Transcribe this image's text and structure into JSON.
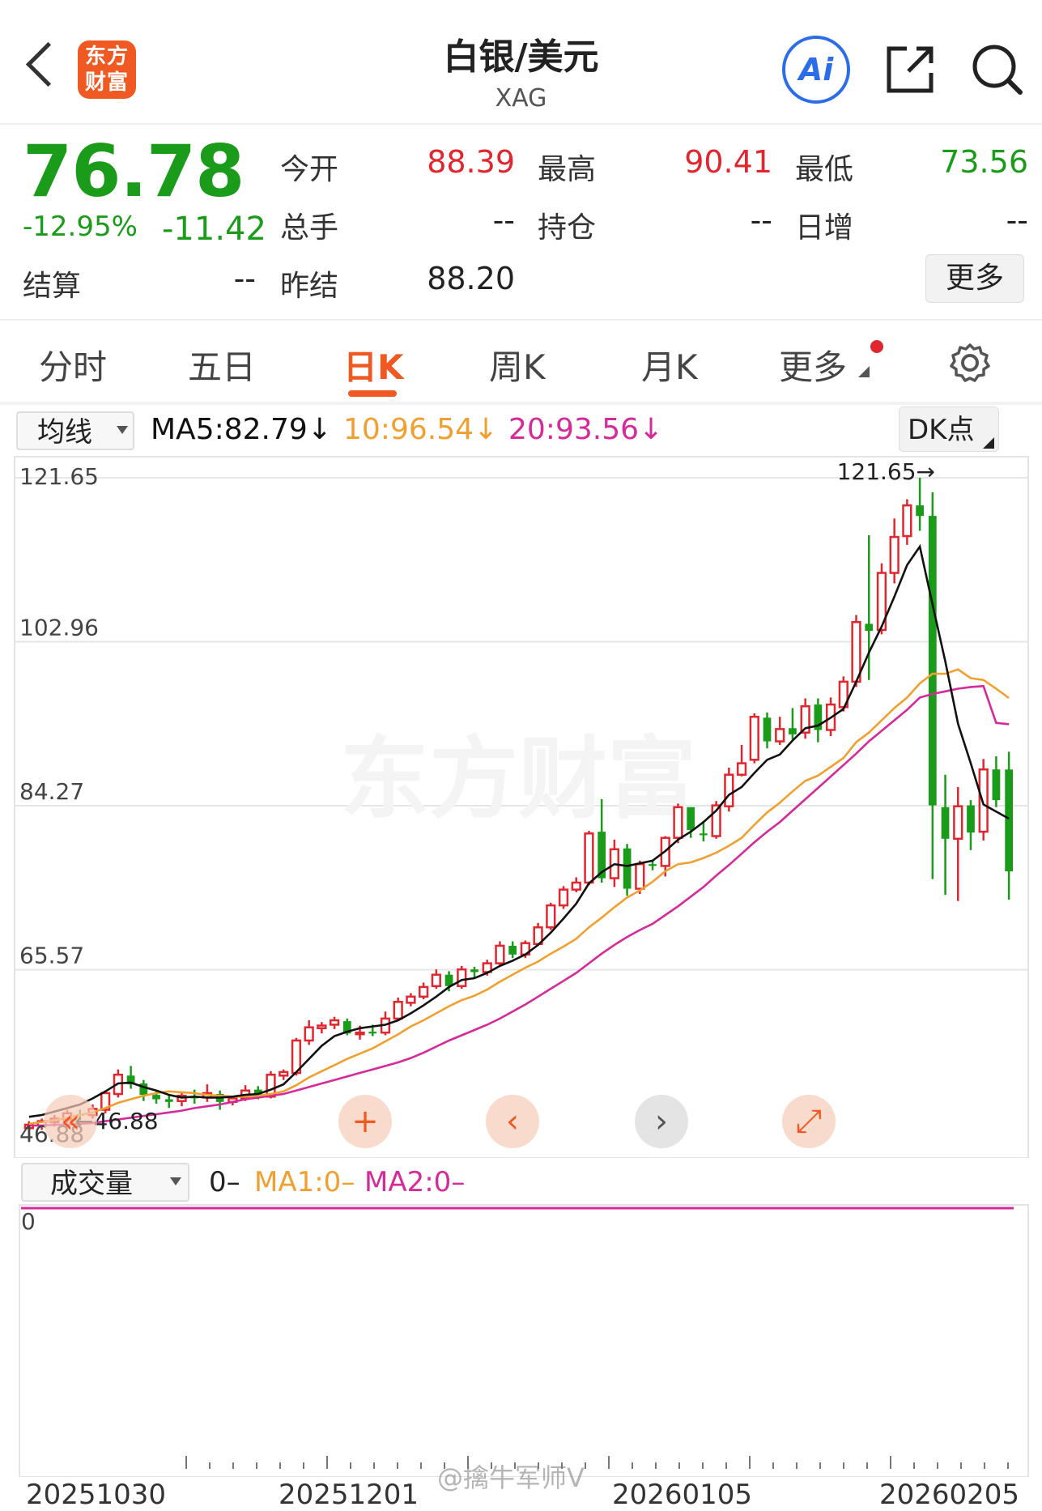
{
  "header": {
    "logo_line1": "东方",
    "logo_line2": "财富",
    "title": "白银/美元",
    "subtitle": "XAG",
    "ai_label": "Ai"
  },
  "quote": {
    "price": "76.78",
    "change_pct": "-12.95%",
    "change": "-11.42",
    "open_label": "今开",
    "open": "88.39",
    "high_label": "最高",
    "high": "90.41",
    "low_label": "最低",
    "low": "73.56",
    "volume_label": "总手",
    "volume": "--",
    "oi_label": "持仓",
    "oi": "--",
    "daily_inc_label": "日增",
    "daily_inc": "--",
    "settle_label": "结算",
    "settle": "--",
    "prev_settle_label": "昨结",
    "prev_settle": "88.20",
    "more_label": "更多"
  },
  "tabs": [
    "分时",
    "五日",
    "日K",
    "周K",
    "月K",
    "更多"
  ],
  "ma_bar": {
    "select_label": "均线",
    "ma5": "MA5:82.79↓",
    "ma10": "10:96.54↓",
    "ma20": "20:93.56↓",
    "dk_label": "DK点"
  },
  "colors": {
    "up": "#e0262e",
    "down": "#1a9b1a",
    "ma5": "#111111",
    "ma10": "#f0a030",
    "ma20": "#d42a9a",
    "accent": "#f05a22"
  },
  "watermark": "东方财富",
  "social_watermark": "@擒牛军师V",
  "chart_data": {
    "type": "candlestick",
    "y_ticks": [
      "121.65",
      "102.96",
      "84.27",
      "65.57"
    ],
    "ylim": [
      46.88,
      121.65
    ],
    "high_marker": "121.65→",
    "low_marker": "←46.88",
    "low_axis_label": "46.88",
    "candles": [
      [
        47.5,
        47.9,
        46.9,
        48.3
      ],
      [
        47.8,
        48.3,
        47.3,
        48.6
      ],
      [
        48.2,
        48.6,
        47.7,
        49.0
      ],
      [
        48.5,
        49.2,
        48.1,
        49.6
      ],
      [
        49.1,
        49.0,
        48.4,
        49.6
      ],
      [
        49.0,
        49.7,
        48.6,
        50.2
      ],
      [
        49.6,
        51.5,
        49.2,
        51.8
      ],
      [
        51.4,
        53.6,
        51.0,
        54.2
      ],
      [
        53.5,
        52.5,
        52.0,
        54.6
      ],
      [
        52.6,
        51.3,
        50.6,
        53.0
      ],
      [
        51.3,
        50.8,
        50.3,
        51.8
      ],
      [
        50.8,
        50.5,
        49.8,
        51.4
      ],
      [
        50.6,
        51.2,
        50.0,
        51.6
      ],
      [
        51.1,
        50.9,
        50.3,
        51.9
      ],
      [
        51.0,
        51.5,
        50.5,
        52.5
      ],
      [
        51.4,
        50.5,
        49.6,
        51.8
      ],
      [
        50.5,
        50.9,
        50.1,
        51.2
      ],
      [
        50.9,
        51.8,
        50.6,
        52.4
      ],
      [
        51.9,
        51.0,
        50.8,
        52.3
      ],
      [
        51.1,
        53.6,
        50.9,
        54.0
      ],
      [
        53.5,
        53.9,
        53.0,
        54.2
      ],
      [
        53.8,
        57.5,
        53.5,
        57.8
      ],
      [
        57.5,
        59.0,
        57.0,
        59.8
      ],
      [
        58.9,
        59.2,
        58.3,
        59.6
      ],
      [
        59.3,
        59.8,
        58.8,
        60.2
      ],
      [
        59.7,
        58.3,
        58.1,
        60.0
      ],
      [
        58.4,
        58.4,
        57.6,
        59.2
      ],
      [
        58.5,
        58.3,
        58.0,
        59.3
      ],
      [
        58.4,
        60.0,
        58.1,
        60.8
      ],
      [
        60.0,
        61.9,
        59.8,
        62.4
      ],
      [
        61.8,
        62.5,
        61.4,
        62.9
      ],
      [
        62.5,
        63.6,
        62.2,
        64.1
      ],
      [
        63.7,
        65.0,
        63.4,
        65.6
      ],
      [
        65.0,
        63.7,
        63.1,
        65.4
      ],
      [
        63.7,
        65.6,
        63.4,
        66.0
      ],
      [
        65.6,
        65.3,
        64.6,
        65.9
      ],
      [
        65.3,
        66.3,
        64.9,
        66.7
      ],
      [
        66.3,
        68.3,
        66.0,
        68.8
      ],
      [
        68.3,
        67.3,
        66.9,
        68.8
      ],
      [
        67.3,
        68.6,
        66.9,
        68.9
      ],
      [
        68.5,
        70.4,
        68.3,
        70.9
      ],
      [
        70.4,
        72.9,
        70.1,
        73.2
      ],
      [
        72.9,
        74.7,
        72.5,
        75.1
      ],
      [
        74.7,
        75.5,
        74.4,
        76.1
      ],
      [
        75.5,
        81.1,
        75.2,
        81.4
      ],
      [
        81.3,
        76.0,
        75.5,
        85.0
      ],
      [
        76.0,
        79.3,
        75.0,
        80.4
      ],
      [
        79.4,
        74.8,
        74.0,
        79.9
      ],
      [
        74.8,
        77.6,
        74.2,
        78.0
      ],
      [
        77.6,
        77.4,
        76.9,
        78.1
      ],
      [
        77.4,
        80.6,
        76.2,
        80.8
      ],
      [
        80.6,
        84.1,
        80.0,
        84.5
      ],
      [
        84.1,
        81.5,
        80.6,
        83.2
      ],
      [
        81.1,
        80.9,
        80.2,
        82.5
      ],
      [
        80.8,
        84.3,
        80.5,
        84.8
      ],
      [
        84.2,
        87.8,
        83.6,
        88.6
      ],
      [
        87.8,
        89.1,
        87.6,
        91.2
      ],
      [
        89.5,
        94.4,
        89.1,
        94.8
      ],
      [
        94.3,
        91.6,
        90.8,
        94.9
      ],
      [
        91.6,
        93.0,
        91.2,
        94.4
      ],
      [
        93.1,
        92.4,
        91.8,
        95.4
      ],
      [
        92.6,
        95.6,
        91.9,
        96.5
      ],
      [
        95.8,
        92.9,
        91.5,
        96.5
      ],
      [
        92.9,
        95.8,
        92.2,
        96.6
      ],
      [
        95.5,
        98.4,
        95.0,
        99.0
      ],
      [
        98.4,
        105.2,
        97.8,
        106.0
      ],
      [
        105.0,
        104.2,
        98.6,
        115.1
      ],
      [
        104.3,
        110.8,
        103.8,
        111.9
      ],
      [
        110.8,
        114.9,
        109.6,
        117.0
      ],
      [
        115.0,
        118.5,
        114.0,
        119.2
      ],
      [
        118.5,
        117.3,
        115.6,
        121.65
      ],
      [
        117.3,
        84.3,
        75.9,
        120.0
      ],
      [
        84.1,
        80.5,
        74.1,
        87.8
      ],
      [
        80.5,
        84.2,
        73.4,
        86.4
      ],
      [
        84.3,
        81.2,
        79.2,
        84.9
      ],
      [
        81.3,
        88.4,
        80.3,
        89.6
      ],
      [
        88.4,
        84.9,
        84.1,
        89.9
      ],
      [
        88.39,
        76.78,
        73.56,
        90.41
      ]
    ],
    "ma5": [
      48.8,
      49.0,
      49.4,
      49.8,
      50.2,
      50.9,
      51.7,
      52.6,
      52.7,
      52.2,
      51.8,
      51.3,
      51.0,
      51.1,
      51.0,
      51.0,
      51.1,
      51.3,
      51.4,
      51.9,
      52.5,
      53.9,
      55.4,
      56.9,
      58.0,
      58.5,
      58.9,
      59.1,
      59.3,
      59.8,
      60.6,
      61.5,
      62.5,
      63.6,
      64.4,
      64.6,
      65.2,
      66.0,
      66.6,
      67.3,
      68.4,
      69.8,
      71.4,
      73.1,
      75.4,
      76.7,
      77.6,
      77.4,
      77.7,
      78.0,
      79.1,
      80.4,
      81.3,
      82.4,
      83.7,
      85.5,
      86.4,
      88.0,
      89.5,
      90.1,
      91.7,
      93.1,
      93.4,
      94.3,
      95.3,
      98.4,
      101.7,
      104.7,
      108.1,
      111.7,
      113.8,
      107.2,
      100.7,
      93.6,
      89.1,
      84.4,
      83.6,
      82.79
    ],
    "ma10": [
      48.0,
      48.2,
      48.4,
      48.7,
      49.0,
      49.3,
      49.8,
      50.4,
      50.8,
      51.2,
      51.5,
      51.7,
      51.6,
      51.5,
      51.3,
      51.2,
      51.1,
      51.1,
      51.2,
      51.4,
      51.7,
      52.4,
      53.3,
      54.0,
      54.7,
      55.4,
      56.0,
      56.6,
      57.4,
      58.2,
      59.1,
      59.8,
      60.6,
      61.4,
      62.1,
      62.6,
      63.3,
      64.2,
      65.0,
      65.8,
      66.5,
      67.4,
      68.2,
      69.1,
      70.4,
      71.5,
      72.7,
      73.8,
      74.6,
      75.6,
      76.8,
      77.6,
      77.8,
      78.3,
      78.9,
      79.7,
      80.6,
      82.1,
      83.5,
      84.6,
      85.9,
      87.1,
      87.7,
      88.7,
      89.7,
      91.5,
      92.6,
      94.0,
      95.4,
      96.6,
      98.2,
      99.3,
      99.3,
      99.8,
      98.8,
      98.6,
      97.6,
      96.54
    ],
    "ma20": [
      47.8,
      47.8,
      47.9,
      47.9,
      48.0,
      48.1,
      48.3,
      48.5,
      48.7,
      48.9,
      49.1,
      49.3,
      49.5,
      49.8,
      50.0,
      50.2,
      50.5,
      50.8,
      51.0,
      51.2,
      51.4,
      51.8,
      52.2,
      52.6,
      53.0,
      53.4,
      53.8,
      54.2,
      54.6,
      55.0,
      55.5,
      56.1,
      56.8,
      57.5,
      58.1,
      58.7,
      59.3,
      60.0,
      60.8,
      61.6,
      62.5,
      63.4,
      64.3,
      65.2,
      66.3,
      67.4,
      68.4,
      69.3,
      70.1,
      70.8,
      71.8,
      72.8,
      73.9,
      75.0,
      76.3,
      77.5,
      78.8,
      80.1,
      81.3,
      82.4,
      83.7,
      85.0,
      86.3,
      87.6,
      88.9,
      90.2,
      91.6,
      92.8,
      94.0,
      95.2,
      96.6,
      97.0,
      97.3,
      97.6,
      97.8,
      97.9,
      93.7,
      93.56
    ],
    "x_tick_labels": [
      "20251030",
      "20251201",
      "20260105",
      "20260205"
    ],
    "volume": {
      "select_label": "成交量",
      "value": "0–",
      "ma1": "MA1:0–",
      "ma2": "MA2:0–",
      "axis_zero": "0",
      "values": [
        0
      ]
    }
  }
}
